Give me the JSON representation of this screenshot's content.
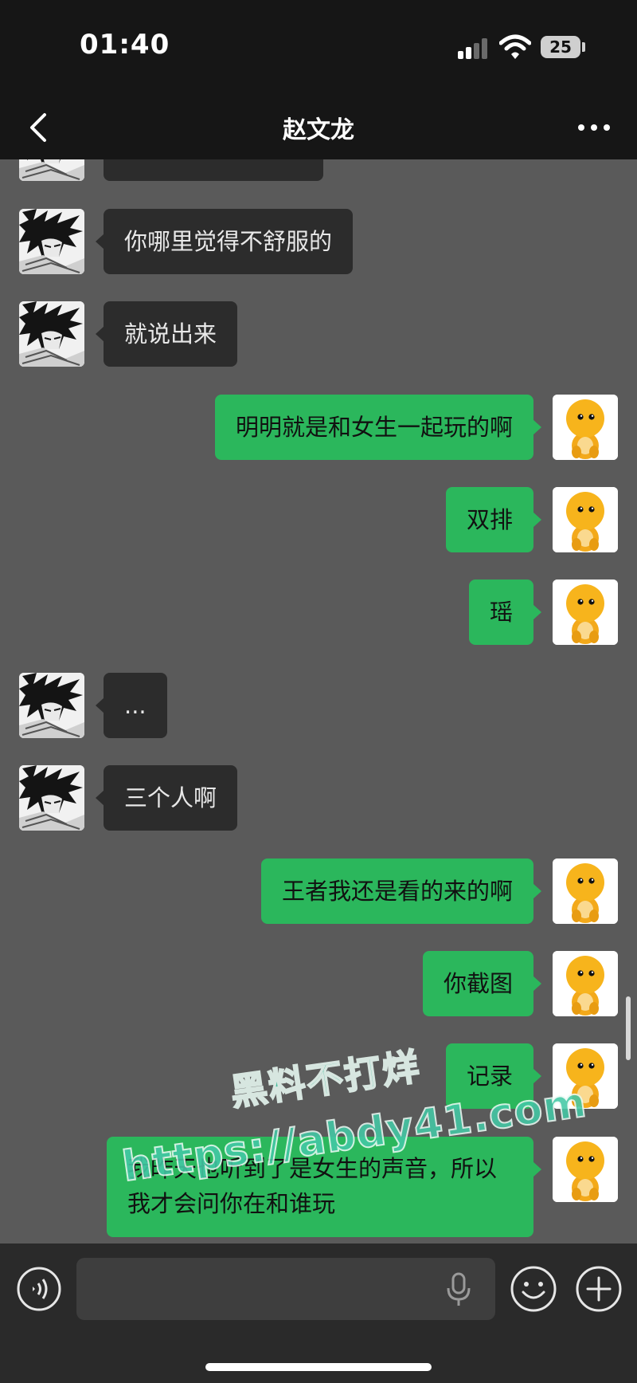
{
  "status_bar": {
    "time": "01:40",
    "battery": "25"
  },
  "header": {
    "title": "赵文龙"
  },
  "messages": [
    {
      "side": "in",
      "text": ""
    },
    {
      "side": "in",
      "text": "你哪里觉得不舒服的"
    },
    {
      "side": "in",
      "text": "就说出来"
    },
    {
      "side": "out",
      "text": "明明就是和女生一起玩的啊"
    },
    {
      "side": "out",
      "text": "双排"
    },
    {
      "side": "out",
      "text": "瑶"
    },
    {
      "side": "in",
      "text": "..."
    },
    {
      "side": "in",
      "text": "三个人啊"
    },
    {
      "side": "out",
      "text": "王者我还是看的来的啊"
    },
    {
      "side": "out",
      "text": "你截图"
    },
    {
      "side": "out",
      "text": "记录"
    },
    {
      "side": "out",
      "text": "我昨天也听到了是女生的声音，所以我才会问你在和谁玩"
    }
  ],
  "watermark": {
    "line1": "黑料不打烊",
    "line2": "https://abdy41.com"
  },
  "input": {
    "value": ""
  },
  "colors": {
    "out_bubble": "#2bb75c",
    "in_bubble": "#2c2c2c",
    "chat_bg": "#5a5a5a",
    "watermark": "#44c9a6"
  },
  "icons": {
    "back": "chevron-left-icon",
    "more": "more-dots-icon",
    "voice": "voice-icon",
    "mic": "mic-icon",
    "emoji": "emoji-icon",
    "plus": "plus-icon",
    "wifi": "wifi-icon",
    "signal": "signal-icon",
    "battery": "battery-icon"
  }
}
